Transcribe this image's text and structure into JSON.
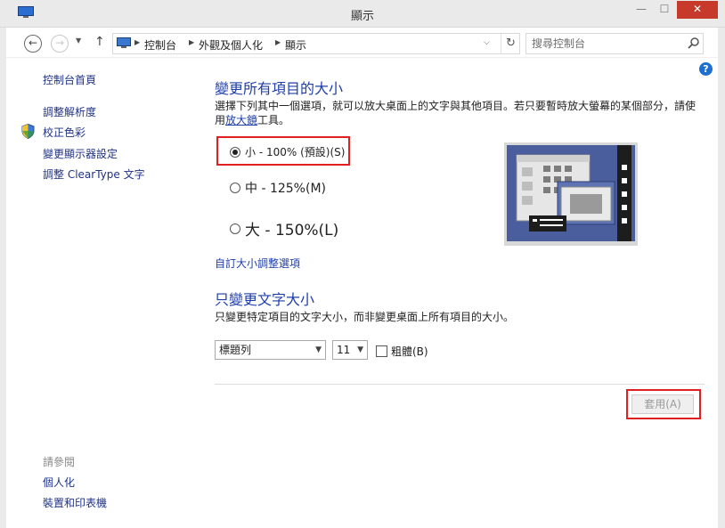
{
  "window": {
    "title": "顯示",
    "min_label": "—",
    "max_label": "☐",
    "close_label": "✕"
  },
  "address": {
    "breadcrumbs": [
      "控制台",
      "外觀及個人化",
      "顯示"
    ],
    "search_placeholder": "搜尋控制台"
  },
  "sidebar": {
    "items": [
      {
        "label": "控制台首頁"
      },
      {
        "label": "調整解析度"
      },
      {
        "label": "校正色彩"
      },
      {
        "label": "變更顯示器設定"
      },
      {
        "label": "調整 ClearType 文字"
      }
    ],
    "see_also_header": "請參閱",
    "see_also": [
      {
        "label": "個人化"
      },
      {
        "label": "裝置和印表機"
      }
    ]
  },
  "main": {
    "heading": "變更所有項目的大小",
    "description_before": "選擇下列其中一個選項，就可以放大桌面上的文字與其他項目。若只要暫時放大螢幕的某個部分，請使用",
    "magnifier_link": "放大鏡",
    "description_after": "工具。",
    "options": [
      {
        "label": "小 - 100% (預設)(S)",
        "selected": true
      },
      {
        "label": "中 - 125%(M)",
        "selected": false
      },
      {
        "label": "大 - 150%(L)",
        "selected": false
      }
    ],
    "custom_size_link": "自訂大小調整選項",
    "text_heading": "只變更文字大小",
    "text_description": "只變更特定項目的文字大小，而非變更桌面上所有項目的大小。",
    "item_select_value": "標題列",
    "size_select_value": "11",
    "bold_label": "粗體(B)",
    "bold_checked": false,
    "apply_label": "套用(A)"
  },
  "colors": {
    "link": "#1e3287",
    "heading": "#1e3ea8",
    "highlight": "#e02020"
  }
}
